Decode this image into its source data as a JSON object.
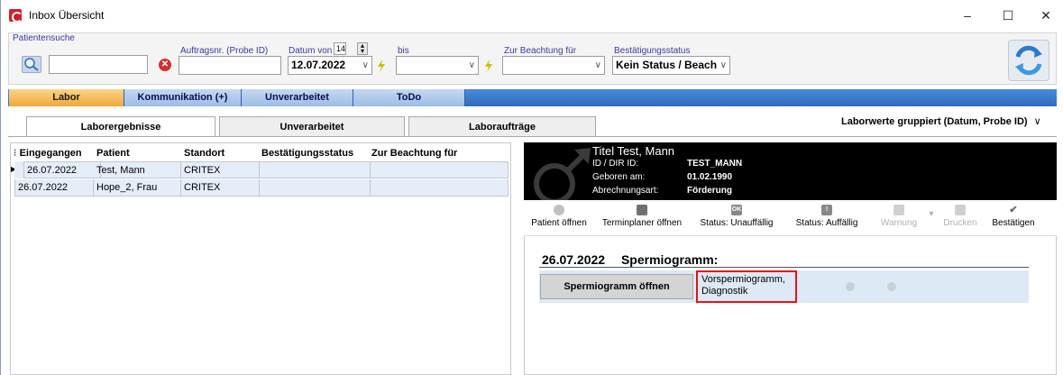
{
  "window": {
    "title": "Inbox Übersicht",
    "controls": {
      "minimize": "–",
      "maximize": "☐",
      "close": "✕"
    }
  },
  "filters": {
    "patient_search_label": "Patientensuche",
    "order_no_label": "Auftragsnr. (Probe ID)",
    "date_from_label": "Datum von",
    "date_from_days": "14",
    "date_from_value": "12.07.2022",
    "date_to_label": "bis",
    "date_to_value": "",
    "attention_label": "Zur Beachtung für",
    "attention_value": "",
    "confirm_status_label": "Bestätigungsstatus",
    "confirm_status_value": "Kein Status / Beach"
  },
  "main_tabs": [
    {
      "label": "Labor",
      "active": true
    },
    {
      "label": "Kommunikation (+)",
      "active": false
    },
    {
      "label": "Unverarbeitet",
      "active": false
    },
    {
      "label": "ToDo",
      "active": false
    }
  ],
  "sub_tabs": [
    {
      "label": "Laborergebnisse",
      "active": true
    },
    {
      "label": "Unverarbeitet",
      "active": false
    },
    {
      "label": "Laboraufträge",
      "active": false
    }
  ],
  "grouping": "Laborwerte gruppiert (Datum, Probe ID)",
  "table": {
    "columns": [
      "Eingegangen",
      "Patient",
      "Standort",
      "Bestätigungsstatus",
      "Zur Beachtung für"
    ],
    "rows": [
      [
        "26.07.2022",
        "Test, Mann",
        "CRITEX",
        "",
        ""
      ],
      [
        "26.07.2022",
        "Hope_2, Frau",
        "CRITEX",
        "",
        ""
      ]
    ]
  },
  "patient": {
    "name": "Titel Test, Mann",
    "id_label": "ID / DIR ID:",
    "id_value": "TEST_MANN",
    "birth_label": "Geboren am:",
    "birth_value": "01.02.1990",
    "billing_label": "Abrechnungsart:",
    "billing_value": "Förderung"
  },
  "toolbar": [
    {
      "label": "Patient öffnen",
      "icon": "person-icon",
      "disabled": false
    },
    {
      "label": "Terminplaner öffnen",
      "icon": "calendar-icon",
      "disabled": false
    },
    {
      "label": "Status: Unauffällig",
      "icon": "ok-icon",
      "glyph": "OK",
      "disabled": false
    },
    {
      "label": "Status: Auffällig",
      "icon": "alert-icon",
      "glyph": "!",
      "disabled": false
    },
    {
      "label": "Warnung",
      "icon": "warning-icon",
      "disabled": true
    },
    {
      "label": "Drucken",
      "icon": "print-icon",
      "disabled": true
    },
    {
      "label": "Bestätigen",
      "icon": "check-icon",
      "glyph": "✔",
      "disabled": false
    }
  ],
  "result": {
    "date": "26.07.2022",
    "title": "Spermiogramm:",
    "open_button": "Spermiogramm öffnen",
    "desc_line1": "Vorspermiogramm,",
    "desc_line2": "Diagnostik"
  },
  "colors": {
    "tab_active": "#f0a838",
    "tab_strip": "#2e6cc2",
    "highlight_border": "#e0141e",
    "result_row_bg": "#dde9f5"
  }
}
